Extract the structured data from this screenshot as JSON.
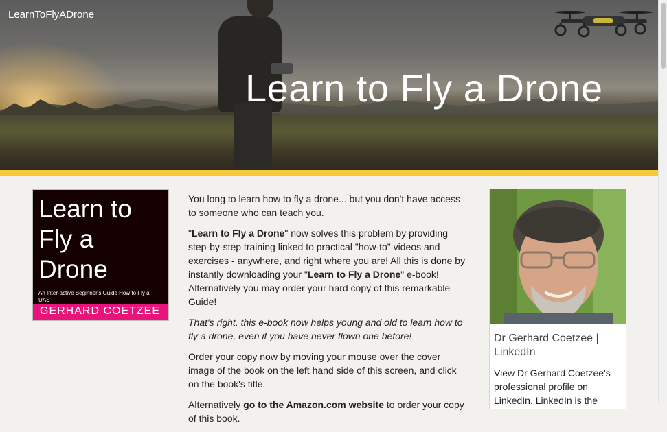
{
  "header": {
    "logo_text": "LearnToFlyADrone",
    "hero_title": "Learn to Fly a Drone"
  },
  "book": {
    "title": "Learn to Fly a Drone",
    "subtitle": "An Inter-active Beginner's Guide How to Fly a UAS",
    "author": "GERHARD COETZEE"
  },
  "main": {
    "p1": "You long to learn how to fly a drone... but you don't have access to someone who can teach you.",
    "p2_q1": "\"",
    "p2_b1": "Learn to Fly a Drone",
    "p2_mid": "\" now solves this problem by providing step-by-step training linked to practical \"how-to\" videos and exercises - anywhere, and right where you are! All this is done by instantly downloading your \"",
    "p2_b2": "Learn to Fly a Drone",
    "p2_end": "\" e-book! Alternatively you may order your hard copy of this remarkable Guide!",
    "p3": "That's right, this e-book now helps young and old to learn how to fly a drone, even if you have never flown one before!",
    "p4": "Order your copy now by moving your mouse over the cover image of the book on the left hand side of this screen, and click on the book's title.",
    "p5_start": "Alternatively ",
    "p5_link": "go to the Amazon.com website",
    "p5_end": " to order your copy of this book."
  },
  "profile_card": {
    "title": "Dr Gerhard Coetzee | LinkedIn",
    "description": "View Dr Gerhard Coetzee's professional profile on LinkedIn. LinkedIn is the"
  },
  "colors": {
    "accent_bar": "#f6c936",
    "book_background": "#140000",
    "book_author_band": "#e8147b"
  }
}
